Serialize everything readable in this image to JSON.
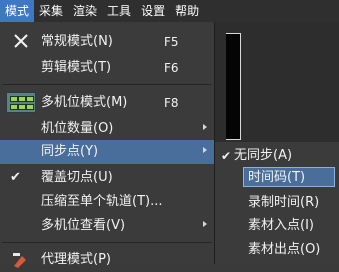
{
  "menubar": {
    "items": [
      {
        "label": "模式"
      },
      {
        "label": "采集"
      },
      {
        "label": "渲染"
      },
      {
        "label": "工具"
      },
      {
        "label": "设置"
      },
      {
        "label": "帮助"
      }
    ],
    "active_index": 0
  },
  "mode_menu": {
    "items": [
      {
        "label": "常规模式(N)",
        "shortcut": "F5",
        "icon": "close-x-icon"
      },
      {
        "label": "剪辑模式(T)",
        "shortcut": "F6"
      },
      {
        "label": "多机位模式(M)",
        "shortcut": "F8",
        "icon": "multicam-icon"
      },
      {
        "label": "机位数量(O)",
        "has_submenu": true
      },
      {
        "label": "同步点(Y)",
        "has_submenu": true,
        "highlighted": true
      },
      {
        "label": "覆盖切点(U)",
        "checked": true
      },
      {
        "label": "压缩至单个轨道(T)..."
      },
      {
        "label": "多机位查看(V)",
        "has_submenu": true
      },
      {
        "label": "代理模式(P)",
        "icon": "proxy-icon"
      }
    ]
  },
  "sync_submenu": {
    "items": [
      {
        "label": "无同步(A)",
        "checked": true
      },
      {
        "label": "时间码(T)",
        "highlighted": true
      },
      {
        "label": "录制时间(R)"
      },
      {
        "label": "素材入点(I)"
      },
      {
        "label": "素材出点(O)"
      }
    ]
  },
  "colors": {
    "menubar_active": "#3e78c4",
    "highlight": "#4a6e9c",
    "menu_bg": "#3b3b3b"
  }
}
